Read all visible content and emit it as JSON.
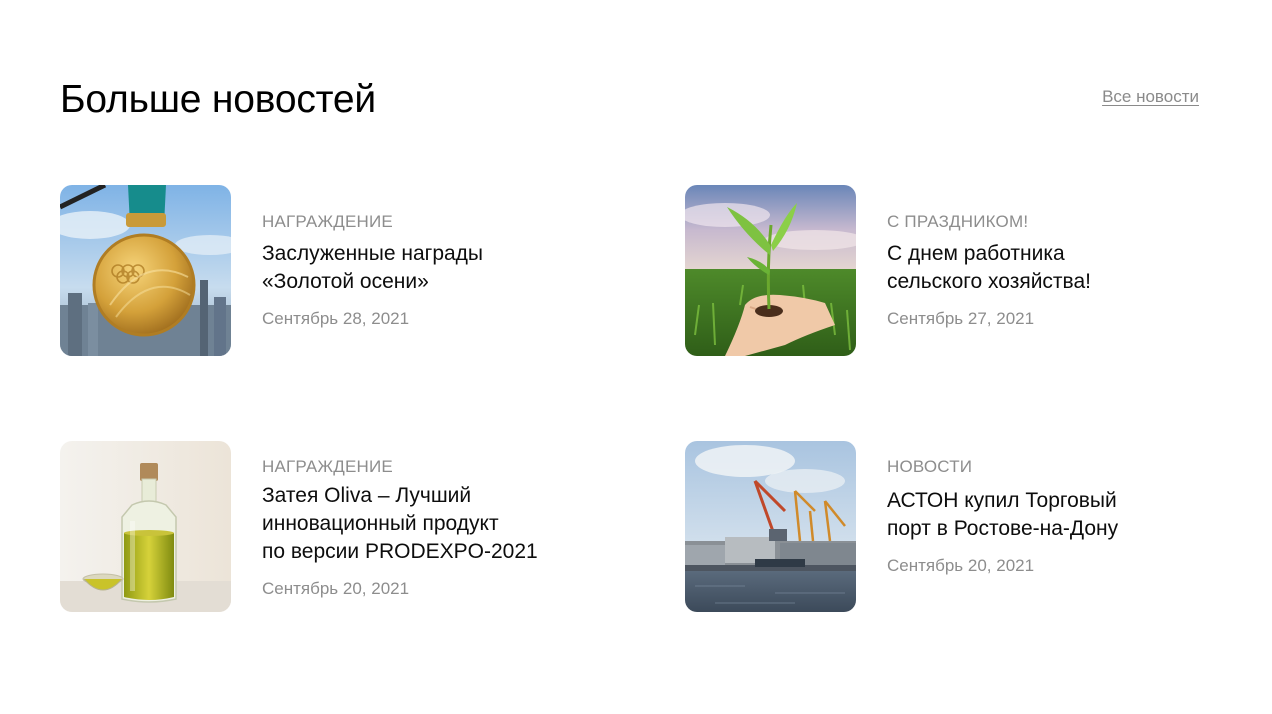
{
  "header": {
    "title": "Больше новостей",
    "all_news_link": "Все новости"
  },
  "news": [
    {
      "category": "НАГРАЖДЕНИЕ",
      "title_lines": [
        "Заслуженные награды",
        "«Золотой осени»"
      ],
      "date": "Сентябрь 28, 2021",
      "image_icon": "gold-medal-photo"
    },
    {
      "category": "С ПРАЗДНИКОМ!",
      "title_lines": [
        "С днем работника",
        "сельского хозяйства!"
      ],
      "date": "Сентябрь 27, 2021",
      "image_icon": "seedling-in-hand-photo"
    },
    {
      "category": "НАГРАЖДЕНИЕ",
      "title_lines": [
        "Затея Oliva – Лучший",
        "инновационный продукт",
        "по версии PRODEXPO-2021"
      ],
      "date": "Сентябрь 20, 2021",
      "image_icon": "olive-oil-bottle-photo"
    },
    {
      "category": "НОВОСТИ",
      "title_lines": [
        "АСТОН купил Торговый",
        "порт в Ростове-на-Дону"
      ],
      "date": "Сентябрь 20, 2021",
      "image_icon": "port-cranes-photo"
    }
  ],
  "colors": {
    "category_text": "#8d8d8d",
    "link_text": "#8a8a8a",
    "title_text": "#000000"
  }
}
